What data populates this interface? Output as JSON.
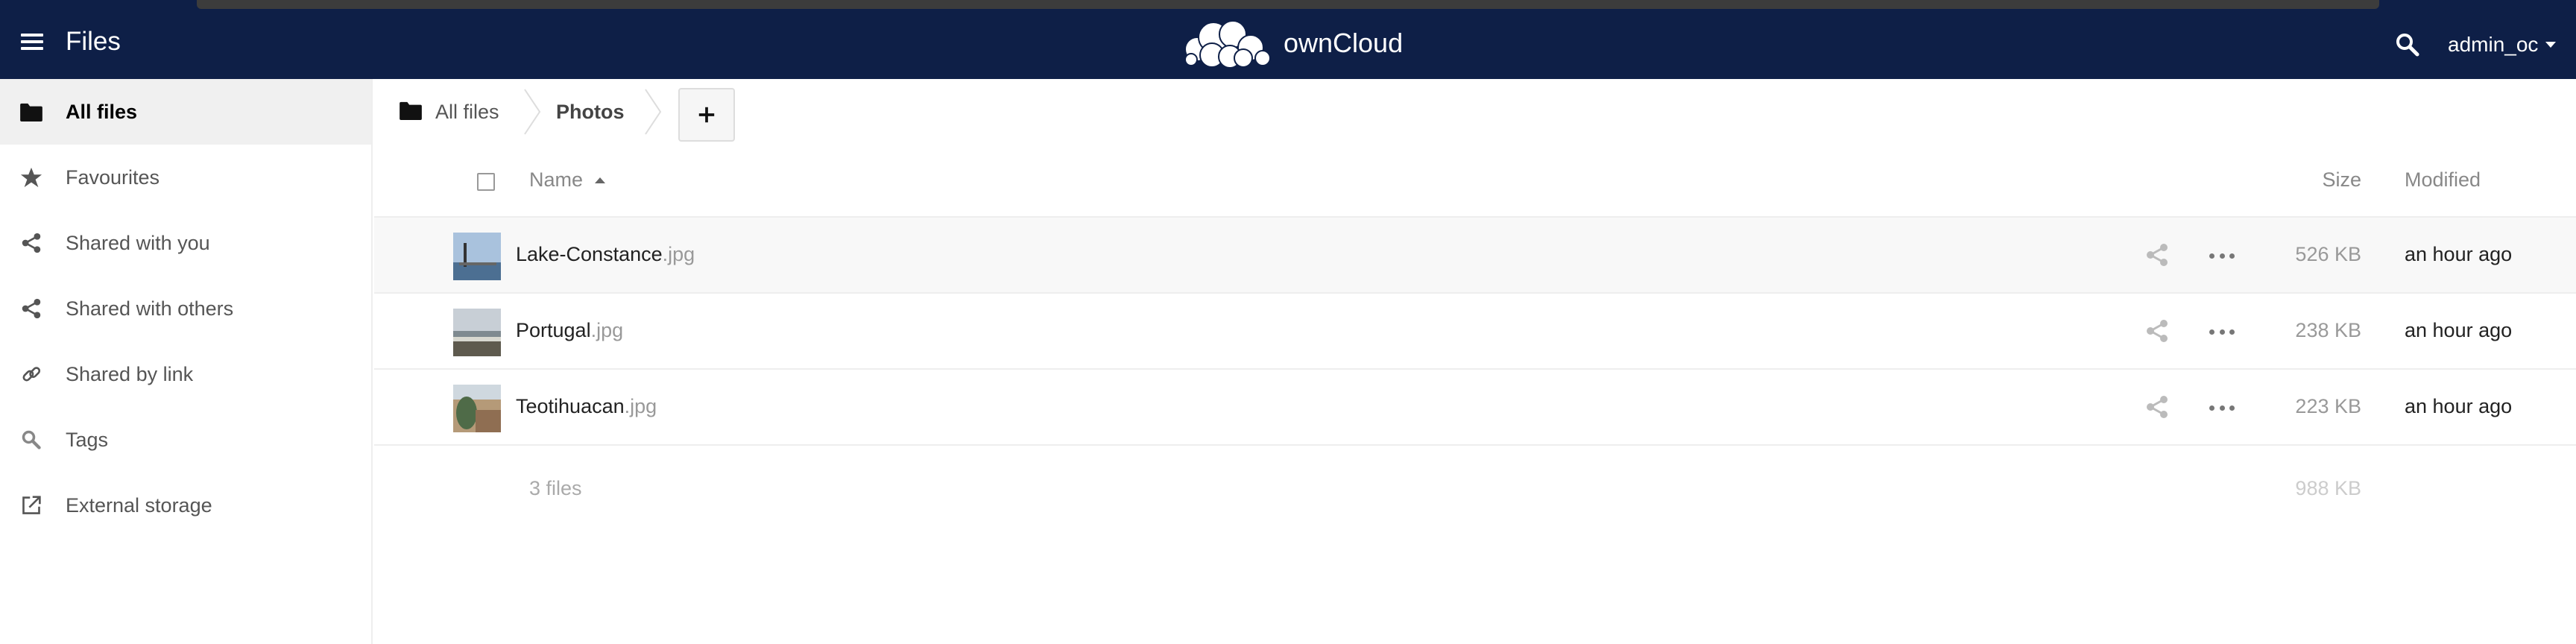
{
  "header": {
    "app_title": "Files",
    "brand": "ownCloud",
    "user": "admin_oc",
    "bg_color": "#0e1f47"
  },
  "sidebar": {
    "items": [
      {
        "label": "All files",
        "icon": "folder-icon",
        "active": true
      },
      {
        "label": "Favourites",
        "icon": "star-icon"
      },
      {
        "label": "Shared with you",
        "icon": "share-icon"
      },
      {
        "label": "Shared with others",
        "icon": "share-icon"
      },
      {
        "label": "Shared by link",
        "icon": "link-icon"
      },
      {
        "label": "Tags",
        "icon": "tag-search-icon"
      },
      {
        "label": "External storage",
        "icon": "external-icon"
      }
    ]
  },
  "breadcrumb": {
    "home": "All files",
    "current": "Photos"
  },
  "table": {
    "columns": {
      "name": "Name",
      "size": "Size",
      "modified": "Modified"
    },
    "files": [
      {
        "name": "Lake-Constance",
        "ext": ".jpg",
        "size": "526 KB",
        "modified": "an hour ago"
      },
      {
        "name": "Portugal",
        "ext": ".jpg",
        "size": "238 KB",
        "modified": "an hour ago"
      },
      {
        "name": "Teotihuacan",
        "ext": ".jpg",
        "size": "223 KB",
        "modified": "an hour ago"
      }
    ],
    "summary": {
      "count": "3 files",
      "size": "988 KB"
    }
  }
}
